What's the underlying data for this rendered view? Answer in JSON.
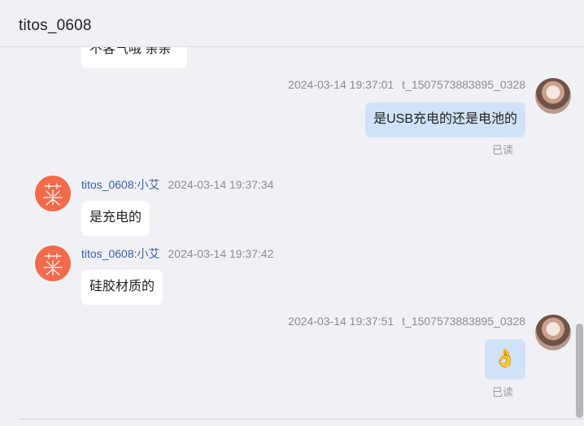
{
  "header": {
    "title": "titos_0608"
  },
  "messages": [
    {
      "direction": "in",
      "text": "不客气哦 亲亲"
    },
    {
      "direction": "out",
      "timestamp": "2024-03-14 19:37:01",
      "sender": "t_1507573883895_0328",
      "text": "是USB充电的还是电池的",
      "status": "已读"
    },
    {
      "direction": "in",
      "sender": "titos_0608:小艾",
      "timestamp": "2024-03-14 19:37:34",
      "text": "是充电的"
    },
    {
      "direction": "in",
      "sender": "titos_0608:小艾",
      "timestamp": "2024-03-14 19:37:42",
      "text": "硅胶材质的"
    },
    {
      "direction": "out",
      "timestamp": "2024-03-14 19:37:51",
      "sender": "t_1507573883895_0328",
      "text": "👌",
      "status": "已读"
    }
  ],
  "colors": {
    "background": "#f0f1f5",
    "outgoing_bubble": "#cfe2f8",
    "incoming_bubble": "#ffffff",
    "sender_name": "#3b5fa8",
    "avatar_logo": "#f26b4b"
  },
  "icons": {
    "agent_avatar": "dragonfly-logo-icon",
    "user_avatar": "user-photo-avatar",
    "emoji": "ok-hand-emoji-icon"
  }
}
